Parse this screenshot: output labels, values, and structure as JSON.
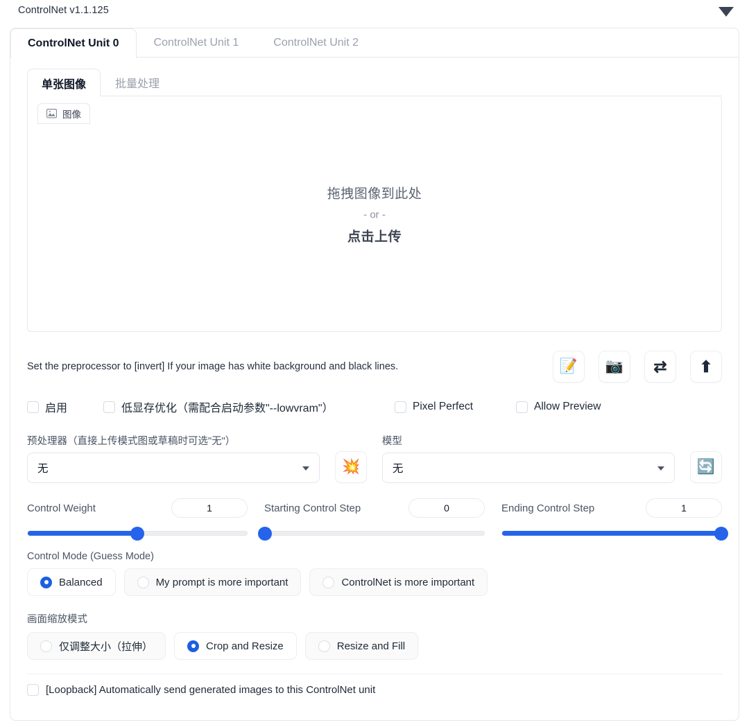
{
  "header": {
    "version": "ControlNet v1.1.125",
    "collapse_icon": "triangle-down-icon"
  },
  "unit_tabs": [
    {
      "label": "ControlNet Unit 0",
      "active": true
    },
    {
      "label": "ControlNet Unit 1",
      "active": false
    },
    {
      "label": "ControlNet Unit 2",
      "active": false
    }
  ],
  "sub_tabs": [
    {
      "label": "单张图像",
      "active": true
    },
    {
      "label": "批量处理",
      "active": false
    }
  ],
  "upload": {
    "chip_label": "图像",
    "chip_icon": "image-icon",
    "drop_line1": "拖拽图像到此处",
    "drop_or": "- or -",
    "drop_line2": "点击上传"
  },
  "hint": {
    "text": "Set the preprocessor to [invert] If your image has white background and black lines.",
    "buttons": [
      {
        "name": "open-new-canvas-button",
        "icon": "memo-pencil-icon",
        "glyph": "📝"
      },
      {
        "name": "webcam-button",
        "icon": "camera-icon",
        "glyph": "📷"
      },
      {
        "name": "mirror-webcam-button",
        "icon": "swap-arrows-icon",
        "glyph": "⇄"
      },
      {
        "name": "send-dimensions-button",
        "icon": "upload-arrow-icon",
        "glyph": "⬆"
      }
    ]
  },
  "checkboxes": [
    {
      "label": "启用",
      "checked": false,
      "name": "enable-checkbox"
    },
    {
      "label": "低显存优化（需配合启动参数\"--lowvram\"）",
      "checked": false,
      "name": "lowvram-checkbox"
    },
    {
      "label": "Pixel Perfect",
      "checked": false,
      "name": "pixel-perfect-checkbox"
    },
    {
      "label": "Allow Preview",
      "checked": false,
      "name": "allow-preview-checkbox"
    }
  ],
  "preprocessor": {
    "label": "预处理器（直接上传模式图或草稿时可选\"无\"）",
    "value": "无",
    "run_icon": "explosion-icon",
    "run_glyph": "💥"
  },
  "model": {
    "label": "模型",
    "value": "无",
    "refresh_icon": "refresh-icon",
    "refresh_glyph": "🔄"
  },
  "sliders": [
    {
      "label": "Control Weight",
      "value": "1",
      "percent": 50,
      "name": "control-weight-slider"
    },
    {
      "label": "Starting Control Step",
      "value": "0",
      "percent": 0,
      "name": "starting-control-step-slider"
    },
    {
      "label": "Ending Control Step",
      "value": "1",
      "percent": 100,
      "name": "ending-control-step-slider"
    }
  ],
  "control_mode": {
    "label": "Control Mode (Guess Mode)",
    "options": [
      {
        "label": "Balanced",
        "selected": true
      },
      {
        "label": "My prompt is more important",
        "selected": false
      },
      {
        "label": "ControlNet is more important",
        "selected": false
      }
    ]
  },
  "resize_mode": {
    "label": "画面缩放模式",
    "options": [
      {
        "label": "仅调整大小（拉伸）",
        "selected": false
      },
      {
        "label": "Crop and Resize",
        "selected": true
      },
      {
        "label": "Resize and Fill",
        "selected": false
      }
    ]
  },
  "loopback": {
    "label": "[Loopback] Automatically send generated images to this ControlNet unit",
    "checked": false
  },
  "colors": {
    "accent_blue": "#2563eb",
    "radio_blue": "#1d5fe0",
    "border": "#e6e8eb",
    "muted_text": "#9aa1ad"
  }
}
